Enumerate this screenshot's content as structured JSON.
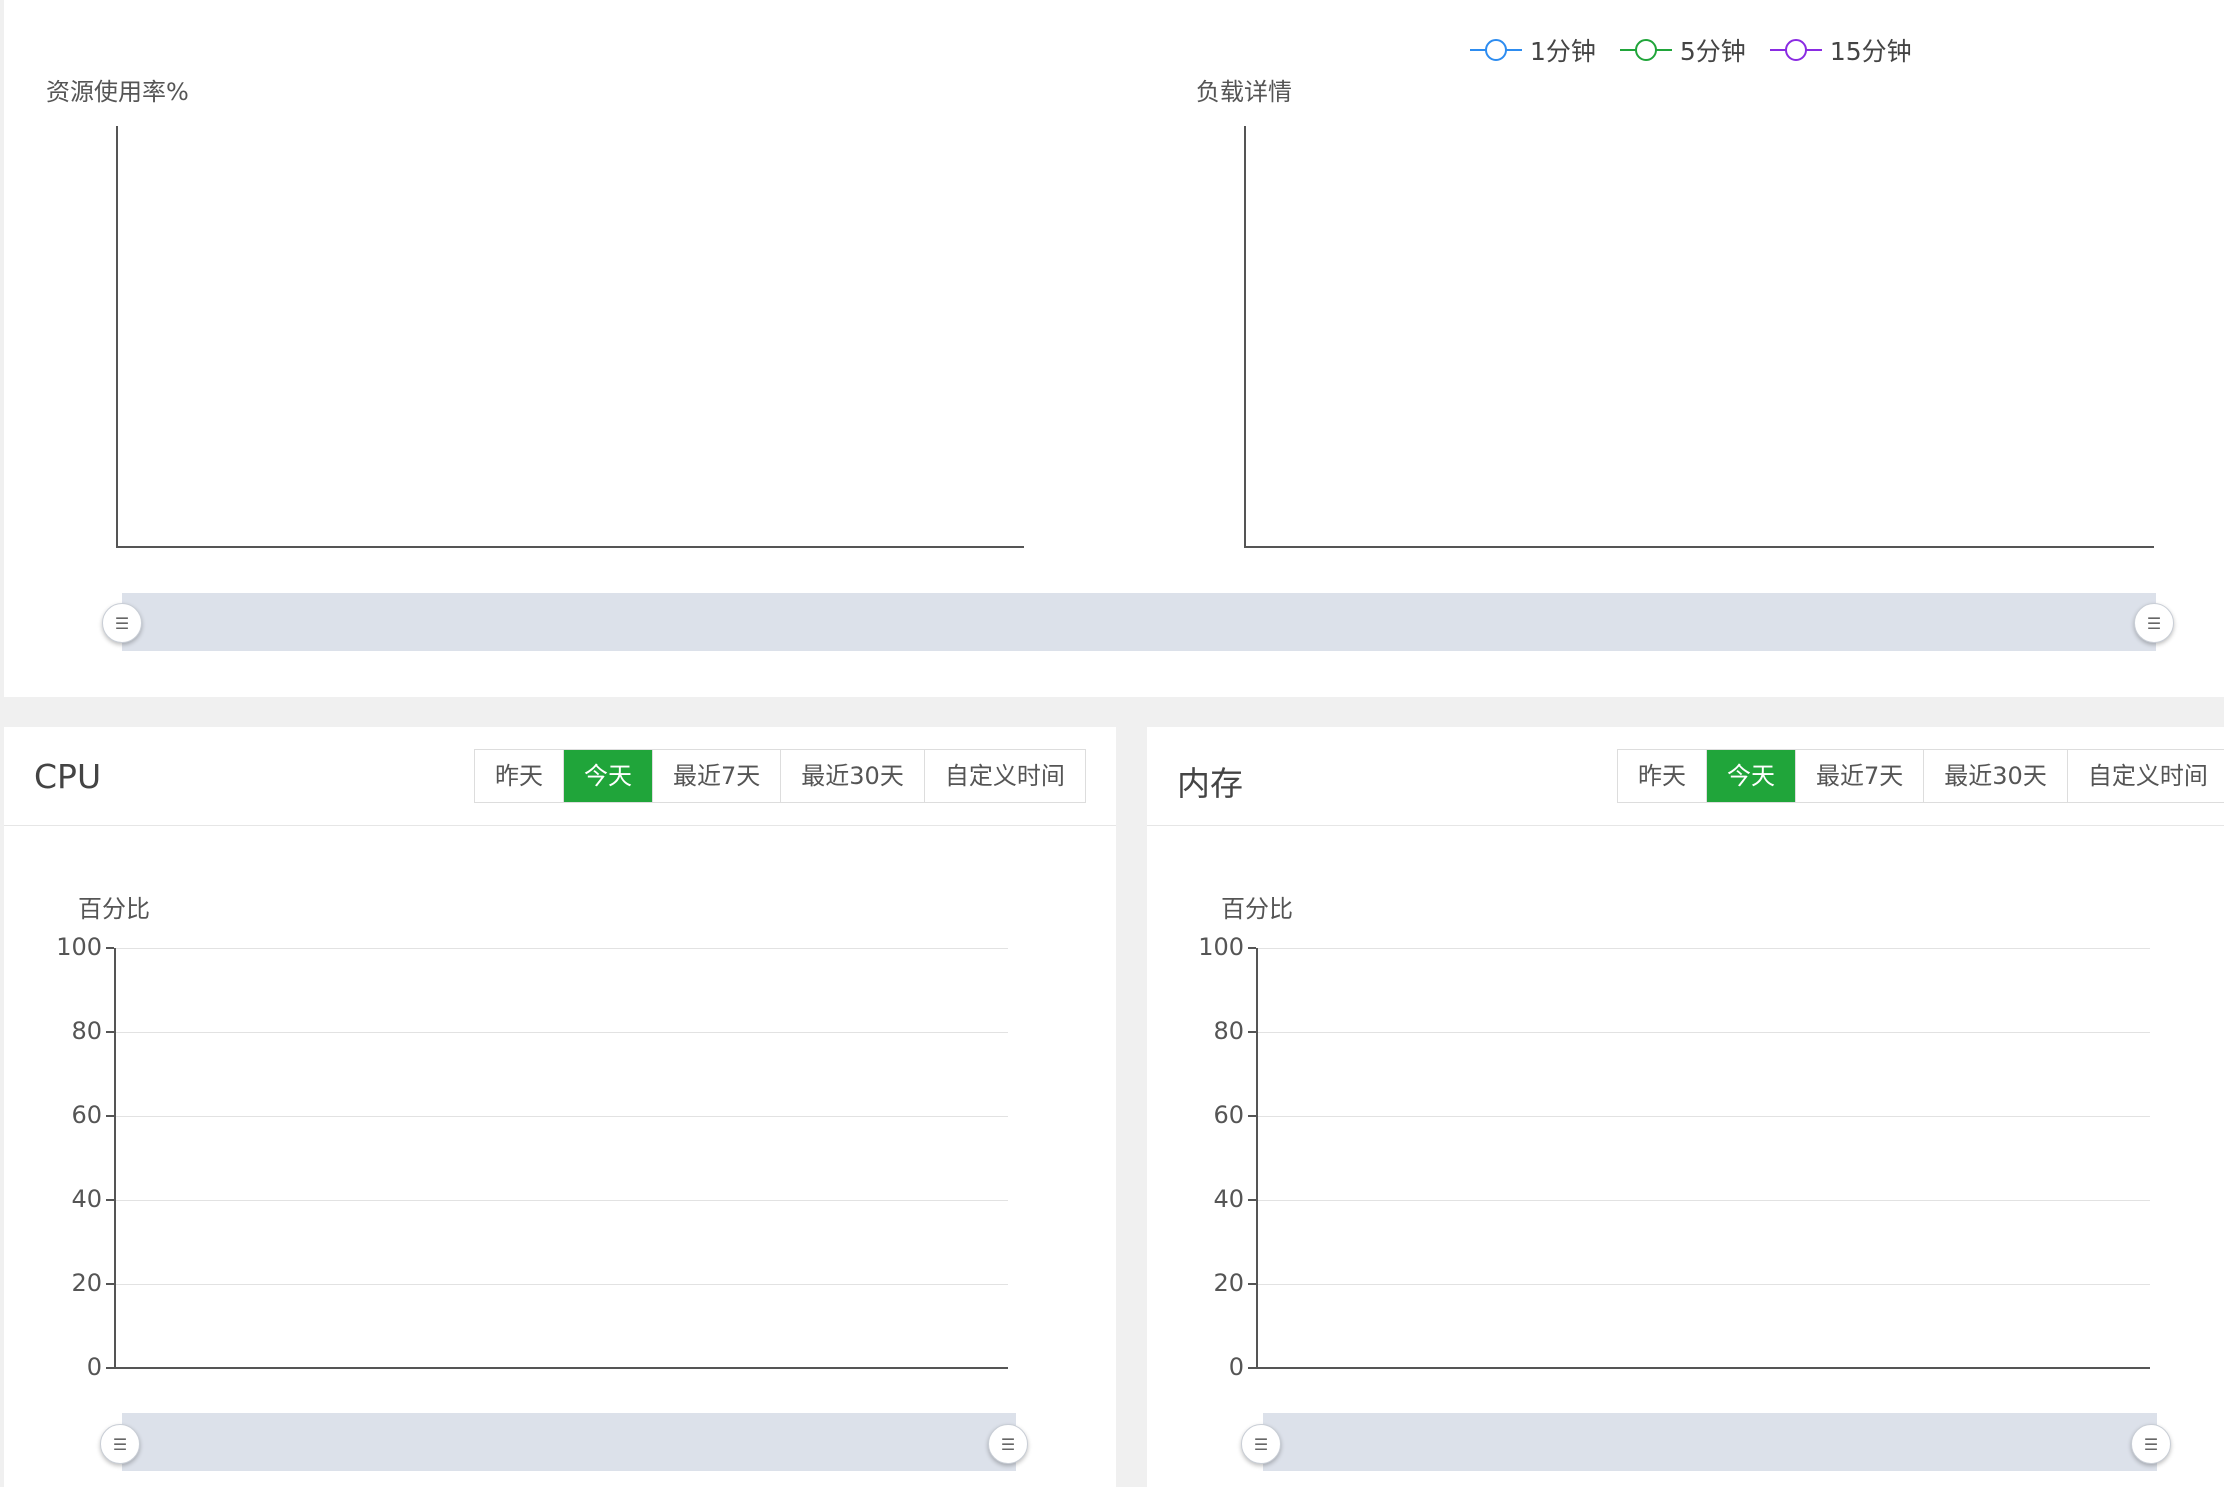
{
  "top": {
    "legend": [
      {
        "label": "1分钟",
        "color": "#2d8cf0"
      },
      {
        "label": "5分钟",
        "color": "#20a53a"
      },
      {
        "label": "15分钟",
        "color": "#8a2be2"
      }
    ],
    "resource_chart_title": "资源使用率%",
    "load_chart_title": "负载详情"
  },
  "cpu": {
    "title": "CPU",
    "buttons": [
      "昨天",
      "今天",
      "最近7天",
      "最近30天",
      "自定义时间"
    ],
    "active_button": "今天",
    "ylabel": "百分比"
  },
  "memory": {
    "title": "内存",
    "buttons": [
      "昨天",
      "今天",
      "最近7天",
      "最近30天",
      "自定义时间"
    ],
    "active_button": "今天",
    "ylabel": "百分比"
  },
  "chart_data": [
    {
      "type": "line",
      "title": "资源使用率%",
      "series": [],
      "x": []
    },
    {
      "type": "line",
      "title": "负载详情",
      "series": [],
      "x": []
    },
    {
      "type": "line",
      "title": "",
      "ylabel": "百分比",
      "ylim": [
        0,
        100
      ],
      "yticks": [
        0,
        20,
        40,
        60,
        80,
        100
      ],
      "series": [],
      "x": []
    },
    {
      "type": "line",
      "title": "",
      "ylabel": "百分比",
      "ylim": [
        0,
        100
      ],
      "yticks": [
        0,
        20,
        40,
        60,
        80,
        100
      ],
      "series": [],
      "x": []
    }
  ],
  "colors": {
    "accent": "#20a53a",
    "zoom_fill": "#dce1ea"
  },
  "icons": {
    "zoom_handle": "grip-lines-icon"
  }
}
